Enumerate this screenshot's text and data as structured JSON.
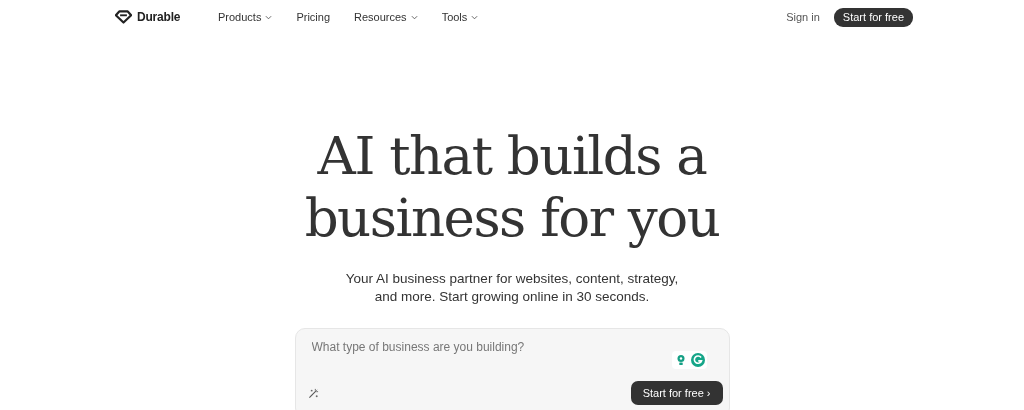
{
  "header": {
    "logo": "Durable",
    "nav": [
      {
        "label": "Products",
        "dropdown": true
      },
      {
        "label": "Pricing",
        "dropdown": false
      },
      {
        "label": "Resources",
        "dropdown": true
      },
      {
        "label": "Tools",
        "dropdown": true
      }
    ],
    "sign_in": "Sign in",
    "cta": "Start for free"
  },
  "hero": {
    "headline": [
      "AI that builds a",
      "business for you"
    ],
    "subtitle": [
      "Your AI business partner for websites, content, strategy,",
      "and more. Start growing online in 30 seconds."
    ],
    "prompt": {
      "placeholder": "What type of business are you building?",
      "button": "Start for free ›"
    }
  }
}
